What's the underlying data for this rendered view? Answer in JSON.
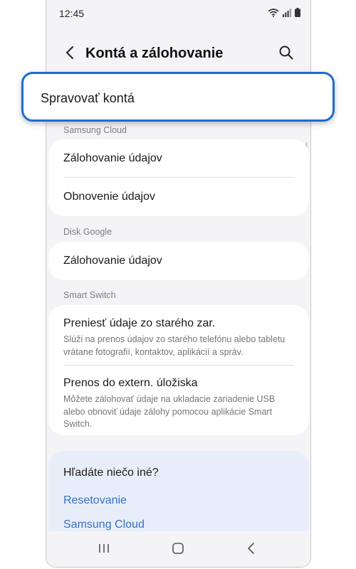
{
  "status": {
    "time": "12:45"
  },
  "header": {
    "title": "Kontá a zálohovanie"
  },
  "highlight": {
    "label": "Spravovať kontá"
  },
  "samsung_cloud": {
    "section_label": "Samsung Cloud",
    "items": [
      {
        "title": "Zálohovanie údajov"
      },
      {
        "title": "Obnovenie údajov"
      }
    ]
  },
  "disk_google": {
    "section_label": "Disk Google",
    "items": [
      {
        "title": "Zálohovanie údajov"
      }
    ]
  },
  "smart_switch": {
    "section_label": "Smart Switch",
    "items": [
      {
        "title": "Preniesť údaje zo starého zar.",
        "subtitle": "Slúži na prenos údajov zo starého telefónu alebo tabletu vrátane fotografií, kontaktov, aplikácií a správ."
      },
      {
        "title": "Prenos do extern. úložiska",
        "subtitle": "Môžete zálohovať údaje na ukladacie zariadenie USB alebo obnoviť údaje zálohy pomocou aplikácie Smart Switch."
      }
    ]
  },
  "help": {
    "title": "Hľadáte niečo iné?",
    "links": [
      "Resetovanie",
      "Samsung Cloud"
    ]
  },
  "colors": {
    "accent": "#1a6ed3",
    "link": "#3a6fc2",
    "help_bg": "#e8eef9"
  },
  "icons": [
    "back-icon",
    "search-icon",
    "wifi-icon",
    "signal-icon",
    "battery-icon",
    "recent-apps-icon",
    "home-icon",
    "nav-back-icon"
  ]
}
